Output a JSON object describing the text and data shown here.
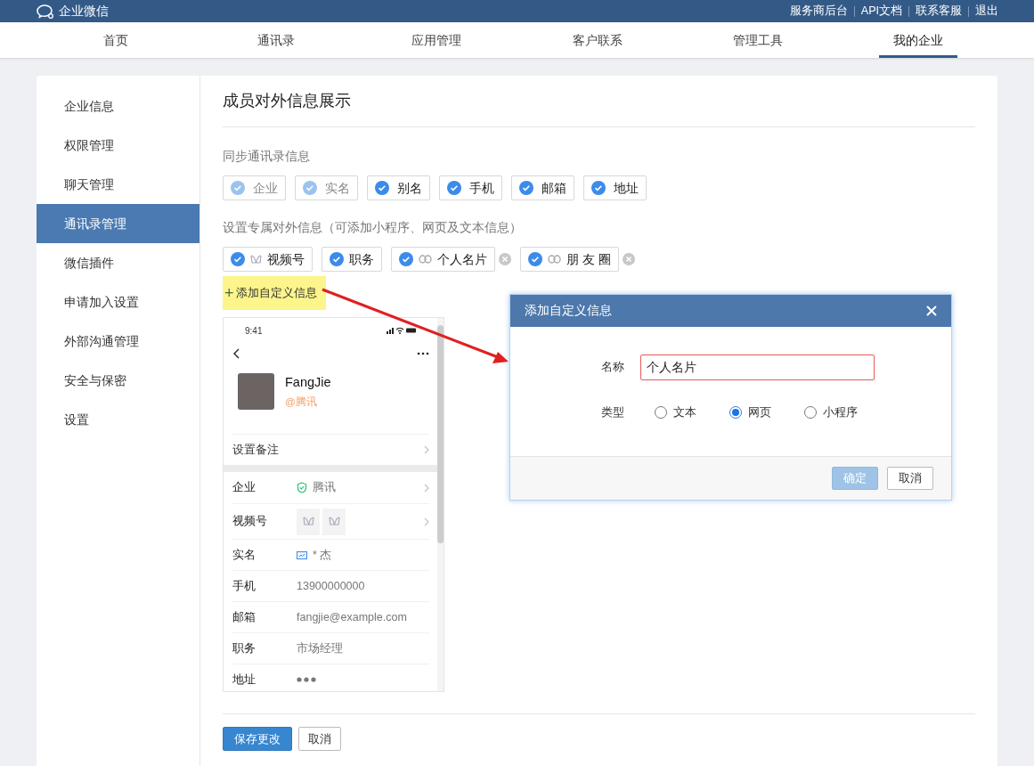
{
  "brand": "企业微信",
  "top_links": [
    "服务商后台",
    "API文档",
    "联系客服",
    "退出"
  ],
  "nav": [
    {
      "label": "首页",
      "selected": false
    },
    {
      "label": "通讯录",
      "selected": false
    },
    {
      "label": "应用管理",
      "selected": false
    },
    {
      "label": "客户联系",
      "selected": false
    },
    {
      "label": "管理工具",
      "selected": false
    },
    {
      "label": "我的企业",
      "selected": true
    }
  ],
  "sidebar": [
    {
      "label": "企业信息",
      "selected": false
    },
    {
      "label": "权限管理",
      "selected": false
    },
    {
      "label": "聊天管理",
      "selected": false
    },
    {
      "label": "通讯录管理",
      "selected": true
    },
    {
      "label": "微信插件",
      "selected": false
    },
    {
      "label": "申请加入设置",
      "selected": false
    },
    {
      "label": "外部沟通管理",
      "selected": false
    },
    {
      "label": "安全与保密",
      "selected": false
    },
    {
      "label": "设置",
      "selected": false
    }
  ],
  "page_title": "成员对外信息展示",
  "sync_label": "同步通讯录信息",
  "sync_tags": [
    {
      "label": "企业",
      "checked": true,
      "disabled": true
    },
    {
      "label": "实名",
      "checked": true,
      "disabled": true
    },
    {
      "label": "别名",
      "checked": true,
      "disabled": false
    },
    {
      "label": "手机",
      "checked": true,
      "disabled": false
    },
    {
      "label": "邮箱",
      "checked": true,
      "disabled": false
    },
    {
      "label": "地址",
      "checked": true,
      "disabled": false
    }
  ],
  "custom_label": "设置专属对外信息（可添加小程序、网页及文本信息）",
  "custom_tags": [
    {
      "label": "视频号",
      "checked": true,
      "kind": "channels",
      "removable": false
    },
    {
      "label": "职务",
      "checked": true,
      "kind": "plain",
      "removable": false
    },
    {
      "label": "个人名片",
      "checked": true,
      "kind": "link",
      "removable": true
    },
    {
      "label": "朋 友 圈",
      "checked": true,
      "kind": "link",
      "removable": true
    }
  ],
  "add_custom": {
    "icon": "+",
    "label": "添加自定义信息"
  },
  "phone": {
    "time": "9:41",
    "name": "FangJie",
    "org": "@腾讯",
    "remark": "设置备注",
    "rows": [
      {
        "label": "企业",
        "value": "腾讯",
        "kind": "verified",
        "arrow": true
      },
      {
        "label": "视频号",
        "kind": "channels",
        "arrow": true
      },
      {
        "label": "实名",
        "value": "* 杰",
        "kind": "realname",
        "arrow": false
      },
      {
        "label": "手机",
        "value": "13900000000",
        "kind": "text",
        "arrow": false
      },
      {
        "label": "邮箱",
        "value": "fangjie@example.com",
        "kind": "text",
        "arrow": false
      },
      {
        "label": "职务",
        "value": "市场经理",
        "kind": "text",
        "arrow": false
      },
      {
        "label": "地址",
        "kind": "dots",
        "arrow": false
      }
    ]
  },
  "dialog": {
    "title": "添加自定义信息",
    "name_label": "名称",
    "name_value": "个人名片",
    "type_label": "类型",
    "types": [
      {
        "label": "文本",
        "selected": false
      },
      {
        "label": "网页",
        "selected": true
      },
      {
        "label": "小程序",
        "selected": false
      }
    ],
    "ok": "确定",
    "cancel": "取消"
  },
  "buttons": {
    "save": "保存更改",
    "cancel": "取消"
  }
}
